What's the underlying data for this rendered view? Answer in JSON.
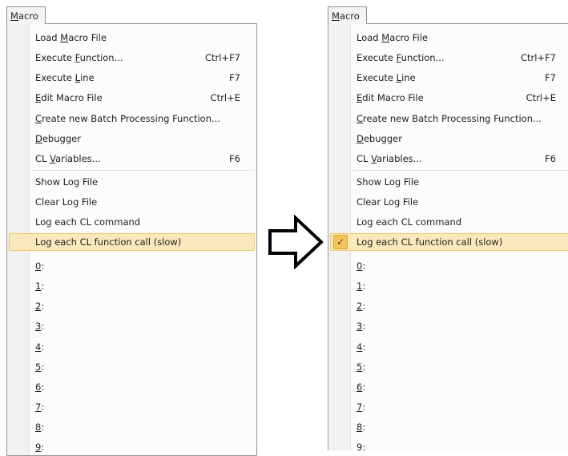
{
  "menu_title": "Macro",
  "arrow_icon": "right-arrow-outline-icon",
  "check_icon": "checkmark-icon",
  "check_glyph": "✓",
  "highlight_color": "#fbe8bd",
  "check_color": "#f7c45b",
  "items": [
    {
      "label": "Load Macro File",
      "shortcut": ""
    },
    {
      "label": "Execute Function...",
      "shortcut": "Ctrl+F7"
    },
    {
      "label": "Execute Line",
      "shortcut": "F7"
    },
    {
      "label": "Edit Macro File",
      "shortcut": "Ctrl+E"
    },
    {
      "label": "Create new Batch Processing Function...",
      "shortcut": ""
    },
    {
      "label": "Debugger",
      "shortcut": ""
    },
    {
      "label": "CL Variables...",
      "shortcut": "F6"
    },
    {
      "label": "Show Log File",
      "shortcut": ""
    },
    {
      "label": "Clear Log File",
      "shortcut": ""
    },
    {
      "label": "Log each CL command",
      "shortcut": ""
    },
    {
      "label": "Log each CL function call (slow)",
      "shortcut": ""
    },
    {
      "label": "0:",
      "shortcut": ""
    },
    {
      "label": "1:",
      "shortcut": ""
    },
    {
      "label": "2:",
      "shortcut": ""
    },
    {
      "label": "3:",
      "shortcut": ""
    },
    {
      "label": "4:",
      "shortcut": ""
    },
    {
      "label": "5:",
      "shortcut": ""
    },
    {
      "label": "6:",
      "shortcut": ""
    },
    {
      "label": "7:",
      "shortcut": ""
    },
    {
      "label": "8:",
      "shortcut": ""
    },
    {
      "label": "9:",
      "shortcut": ""
    }
  ],
  "panels": [
    {
      "name": "before",
      "highlighted_item": "Log each CL function call (slow)",
      "checked": false
    },
    {
      "name": "after",
      "highlighted_item": "Log each CL function call (slow)",
      "checked": true
    }
  ]
}
